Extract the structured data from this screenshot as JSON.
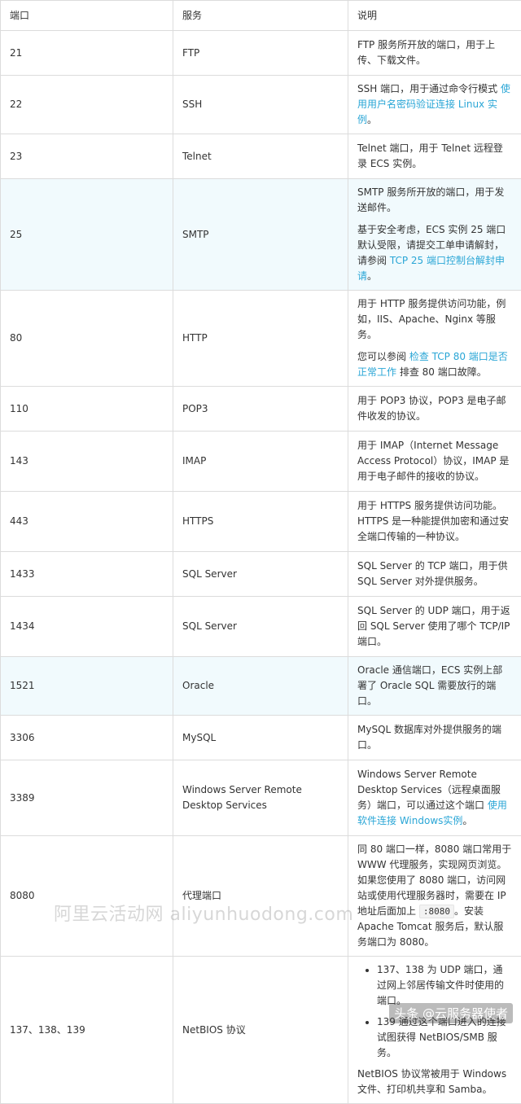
{
  "headers": [
    "端口",
    "服务",
    "说明"
  ],
  "rows": [
    {
      "port": "21",
      "service": "FTP",
      "desc": "FTP 服务所开放的端口，用于上传、下载文件。"
    },
    {
      "port": "22",
      "service": "SSH",
      "desc": "SSH 端口，用于通过命令行模式 ",
      "link": "使用用户名密码验证连接 Linux 实例",
      "after": "。"
    },
    {
      "port": "23",
      "service": "Telnet",
      "desc": "Telnet 端口，用于 Telnet 远程登录 ECS 实例。"
    },
    {
      "port": "25",
      "service": "SMTP",
      "desc": "SMTP 服务所开放的端口，用于发送邮件。",
      "p2": "基于安全考虑，ECS 实例 25 端口默认受限，请提交工单申请解封，请参阅 ",
      "link": "TCP 25 端口控制台解封申请",
      "after": "。"
    },
    {
      "port": "80",
      "service": "HTTP",
      "desc": "用于 HTTP 服务提供访问功能，例如，IIS、Apache、Nginx 等服务。",
      "p2": "您可以参阅 ",
      "link": "检查 TCP 80 端口是否正常工作",
      "after": " 排查 80 端口故障。"
    },
    {
      "port": "110",
      "service": "POP3",
      "desc": "用于 POP3 协议，POP3 是电子邮件收发的协议。"
    },
    {
      "port": "143",
      "service": "IMAP",
      "desc": "用于 IMAP（Internet Message Access Protocol）协议，IMAP 是用于电子邮件的接收的协议。"
    },
    {
      "port": "443",
      "service": "HTTPS",
      "desc": "用于 HTTPS 服务提供访问功能。HTTPS 是一种能提供加密和通过安全端口传输的一种协议。"
    },
    {
      "port": "1433",
      "service": "SQL Server",
      "desc": "SQL Server 的 TCP 端口，用于供 SQL Server 对外提供服务。"
    },
    {
      "port": "1434",
      "service": "SQL Server",
      "desc": "SQL Server 的 UDP 端口，用于返回 SQL Server 使用了哪个 TCP/IP 端口。"
    },
    {
      "port": "1521",
      "service": "Oracle",
      "desc": "Oracle 通信端口，ECS 实例上部署了 Oracle SQL 需要放行的端口。"
    },
    {
      "port": "3306",
      "service": "MySQL",
      "desc": "MySQL 数据库对外提供服务的端口。"
    },
    {
      "port": "3389",
      "service": "Windows Server Remote Desktop Services",
      "desc": "Windows Server Remote Desktop Services（远程桌面服务）端口，可以通过这个端口 ",
      "link": "使用软件连接 Windows实例",
      "after": "。"
    },
    {
      "port": "8080",
      "service": "代理端口",
      "desc": "同 80 端口一样，8080 端口常用于 WWW 代理服务，实现网页浏览。如果您使用了 8080 端口，访问网站或使用代理服务器时，需要在 IP 地址后面加上 ",
      "code": ":8080",
      "after": "。安装 Apache Tomcat 服务后，默认服务端口为 8080。"
    },
    {
      "port": "137、138、139",
      "service": "NetBIOS 协议",
      "li1": "137、138 为 UDP 端口，通过网上邻居传输文件时使用的端口。",
      "li2": "139 通过这个端口进入的连接试图获得 NetBIOS/SMB 服务。",
      "p2": "NetBIOS 协议常被用于 Windows 文件、打印机共享和 Samba。"
    }
  ],
  "watermark": "阿里云活动网 aliyunhuodong.com",
  "credit": "头条 @云服务器使者"
}
